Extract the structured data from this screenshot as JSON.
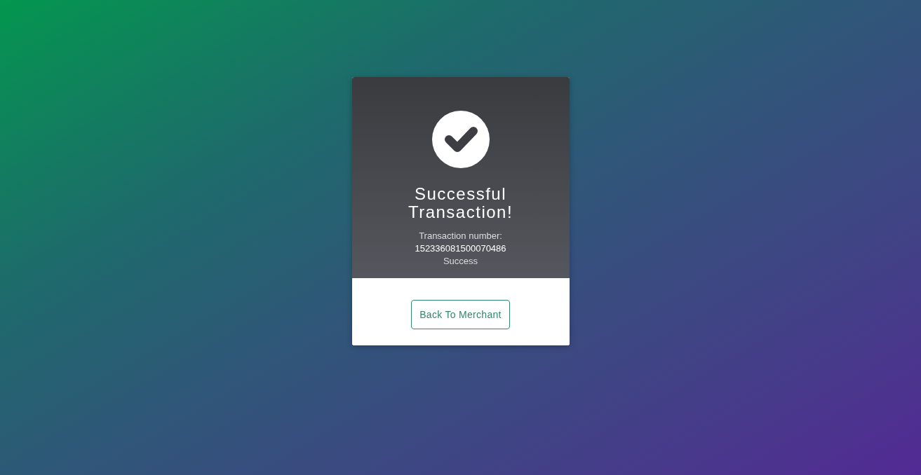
{
  "result": {
    "title": "Successful Transaction!",
    "number_label": "Transaction number:",
    "number": "152336081500070486",
    "status": "Success"
  },
  "actions": [
    {
      "label": "Back To Merchant"
    }
  ]
}
